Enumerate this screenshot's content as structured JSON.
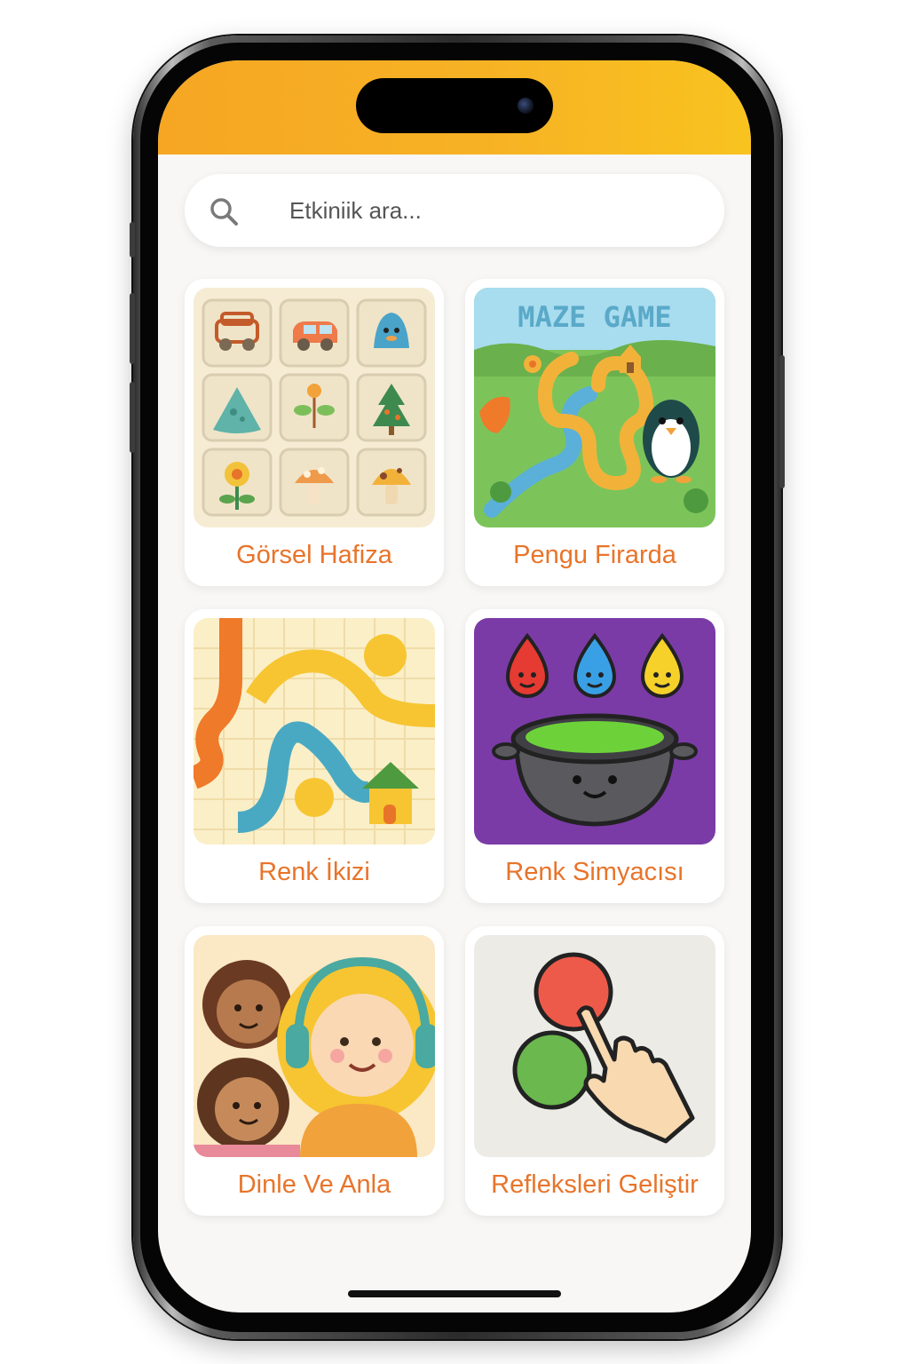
{
  "search": {
    "placeholder": "Etkiniik ara..."
  },
  "activities": [
    {
      "title": "Görsel Hafiza"
    },
    {
      "title": "Pengu Firarda",
      "image_text": "MAZE GAME"
    },
    {
      "title": "Renk İkizi"
    },
    {
      "title": "Renk Simyacısı"
    },
    {
      "title": "Dinle Ve Anla"
    },
    {
      "title": "Refleksleri Geliştir"
    }
  ],
  "colors": {
    "header_start": "#f6a623",
    "header_end": "#f8c31f",
    "title_orange": "#e8742a",
    "screen_bg": "#f8f7f5"
  }
}
